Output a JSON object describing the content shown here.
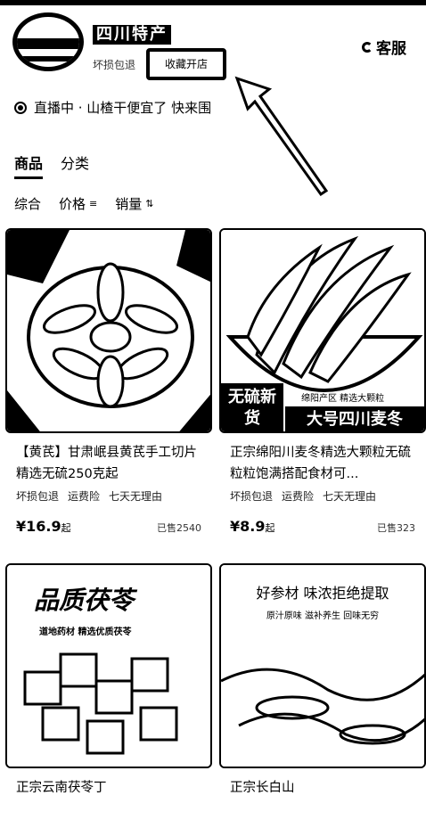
{
  "header": {
    "shop_name": "四川特产",
    "shop_tag": "坏损包退",
    "follow_label": "收藏开店",
    "service_label": "客服"
  },
  "live": {
    "text": "直播中 · 山楂干便宜了 快来围"
  },
  "tabs": [
    {
      "label": "商品",
      "active": true
    },
    {
      "label": "分类",
      "active": false
    }
  ],
  "sort": [
    {
      "label": "综合",
      "mark": ""
    },
    {
      "label": "价格",
      "mark": "≡"
    },
    {
      "label": "销量",
      "mark": "⇅"
    }
  ],
  "products": [
    {
      "title": "【黄芪】甘肃岷县黄芪手工切片精选无硫250克起",
      "tags": [
        "坏损包退",
        "运费险",
        "七天无理由"
      ],
      "price": "¥16.9",
      "price_unit": "起",
      "sold": "已售2540"
    },
    {
      "title": "正宗绵阳川麦冬精选大颗粒无硫粒粒饱满搭配食材可...",
      "tags": [
        "坏损包退",
        "运费险",
        "七天无理由"
      ],
      "price": "¥8.9",
      "price_unit": "起",
      "sold": "已售323",
      "banner_left": "无硫新货",
      "banner_right": "大号四川麦冬",
      "banner_note": "绵阳产区 精选大颗粒"
    },
    {
      "title": "正宗云南茯苓丁",
      "caption": "品质茯苓",
      "subcaption": "道地药材 精选优质茯苓"
    },
    {
      "title": "正宗长白山",
      "caption": "好参材 味浓拒绝提取",
      "subcaption": "原汁原味 滋补养生 回味无穷"
    }
  ]
}
